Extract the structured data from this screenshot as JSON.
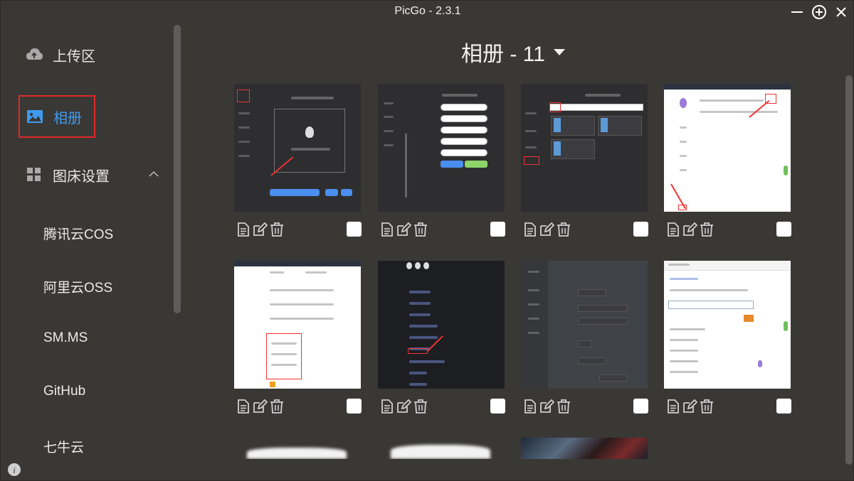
{
  "window": {
    "title": "PicGo - 2.3.1"
  },
  "sidebar": {
    "upload_label": "上传区",
    "gallery_label": "相册",
    "settings_label": "图床设置",
    "sub_items": [
      "腾讯云COS",
      "阿里云OSS",
      "SM.MS",
      "GitHub",
      "七牛云"
    ]
  },
  "gallery": {
    "title": "相册 - 11",
    "image_count": 11,
    "selected_flags": [
      false,
      false,
      false,
      false,
      false,
      false,
      false,
      false
    ]
  },
  "colors": {
    "accent": "#3e9bf0",
    "highlight_border": "#e02727",
    "background": "#3a3835"
  },
  "icons": {
    "upload": "cloud-upload-icon",
    "gallery": "image-icon",
    "settings": "grid-icon",
    "copy": "document-icon",
    "edit": "edit-icon",
    "delete": "trash-icon",
    "info": "info-icon"
  }
}
